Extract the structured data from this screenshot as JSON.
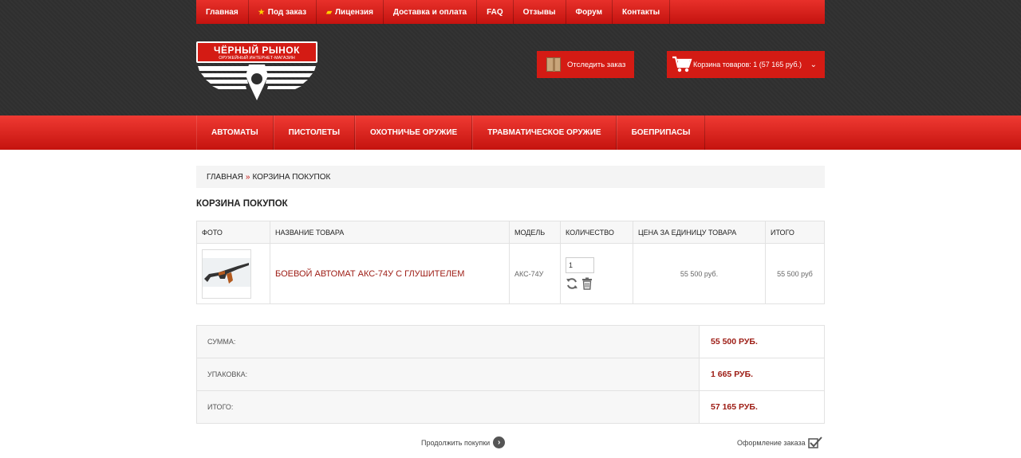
{
  "topnav": {
    "items": [
      {
        "label": "Главная"
      },
      {
        "label": "Под заказ",
        "icon": "star-icon"
      },
      {
        "label": "Лицензия",
        "icon": "pistol-icon"
      },
      {
        "label": "Доставка и оплата"
      },
      {
        "label": "FAQ"
      },
      {
        "label": "Отзывы"
      },
      {
        "label": "Форум"
      },
      {
        "label": "Контакты"
      }
    ]
  },
  "logo": {
    "title": "ЧЁРНЫЙ РЫНОК",
    "subtitle": "ОРУЖЕЙНЫЙ ИНТЕРНЕТ-МАГАЗИН"
  },
  "header": {
    "track_order_label": "Отследить заказ",
    "cart_label": "Корзина товаров: 1 (57 165 руб.)"
  },
  "catnav": {
    "items": [
      "АВТОМАТЫ",
      "ПИСТОЛЕТЫ",
      "ОХОТНИЧЬЕ ОРУЖИЕ",
      "ТРАВМАТИЧЕСКОЕ ОРУЖИЕ",
      "БОЕПРИПАСЫ"
    ]
  },
  "breadcrumb": {
    "home": "ГЛАВНАЯ",
    "separator": "»",
    "current": "КОРЗИНА ПОКУПОК"
  },
  "page_title": "КОРЗИНА ПОКУПОК",
  "cart": {
    "columns": [
      "ФОТО",
      "НАЗВАНИЕ ТОВАРА",
      "МОДЕЛЬ",
      "КОЛИЧЕСТВО",
      "ЦЕНА ЗА ЕДИНИЦУ ТОВАРА",
      "ИТОГО"
    ],
    "rows": [
      {
        "name": "БОЕВОЙ АВТОМАТ АКС-74У С ГЛУШИТЕЛЕМ",
        "model": "АКС-74У",
        "quantity": "1",
        "unit_price": "55 500 руб.",
        "total": "55 500 руб"
      }
    ]
  },
  "totals": [
    {
      "label": "СУММА:",
      "value": "55 500 РУБ."
    },
    {
      "label": "УПАКОВКА:",
      "value": "1 665 РУБ."
    },
    {
      "label": "ИТОГО:",
      "value": "57 165 РУБ."
    }
  ],
  "footer_actions": {
    "continue": "Продолжить покупки",
    "checkout": "Оформление заказа"
  },
  "colors": {
    "accent": "#d41b14",
    "dark": "#2f2f2f",
    "link": "#9c1a12"
  }
}
